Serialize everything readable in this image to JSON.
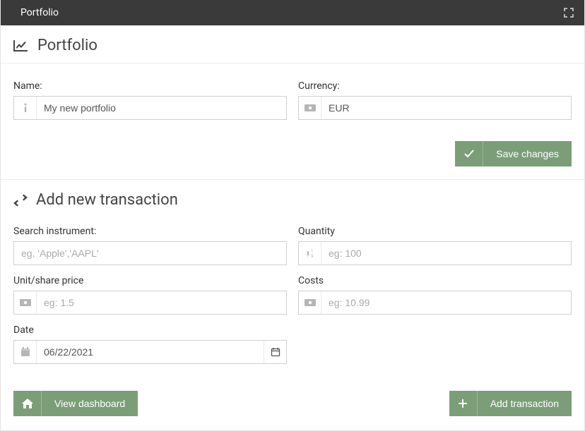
{
  "titlebar": {
    "title": "Portfolio"
  },
  "portfolio": {
    "heading": "Portfolio",
    "name_label": "Name:",
    "name_value": "My new portfolio",
    "currency_label": "Currency:",
    "currency_value": "EUR",
    "save_label": "Save changes"
  },
  "transaction": {
    "heading": "Add new transaction",
    "search_label": "Search instrument:",
    "search_placeholder": "eg. 'Apple','AAPL'",
    "quantity_label": "Quantity",
    "quantity_placeholder": "eg: 100",
    "price_label": "Unit/share price",
    "price_placeholder": "eg: 1.5",
    "costs_label": "Costs",
    "costs_placeholder": "eg: 10.99",
    "date_label": "Date",
    "date_value": "06/22/2021",
    "view_dashboard_label": "View dashboard",
    "add_transaction_label": "Add transaction"
  },
  "colors": {
    "accent": "#7b9e78"
  }
}
